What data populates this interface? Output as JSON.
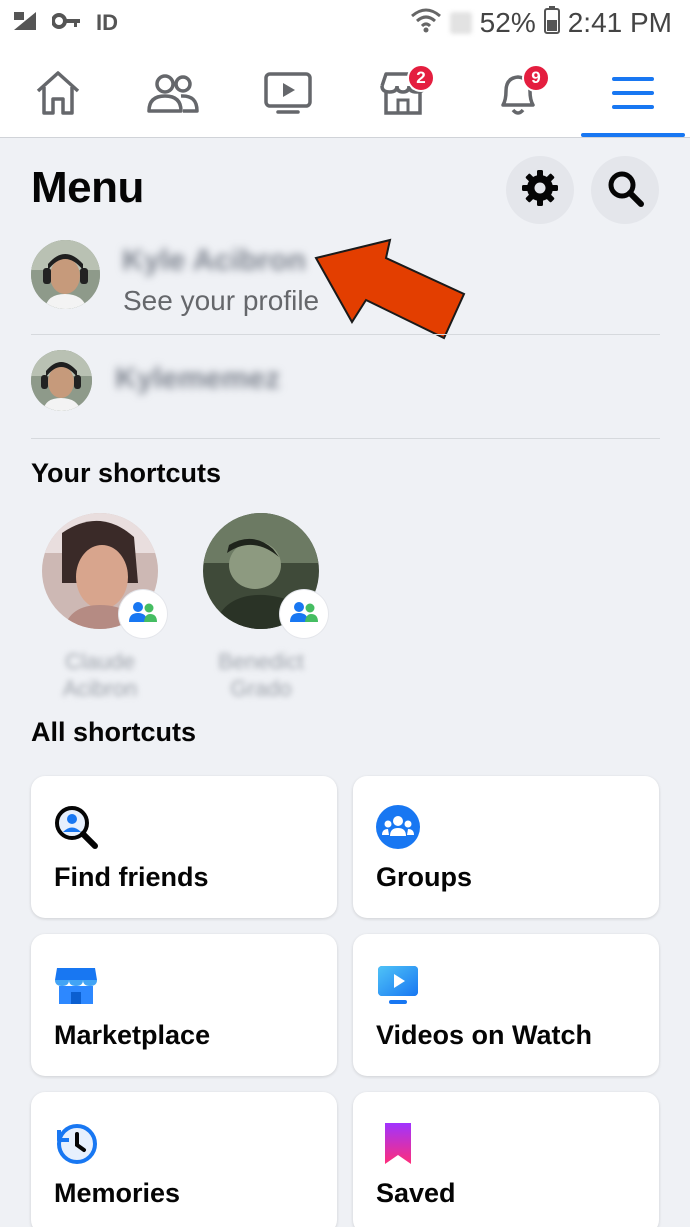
{
  "status_bar": {
    "battery": "52%",
    "time": "2:41 PM"
  },
  "nav": {
    "items": [
      {
        "name": "home",
        "icon": "home-icon"
      },
      {
        "name": "friends",
        "icon": "friends-icon"
      },
      {
        "name": "watch",
        "icon": "watch-icon"
      },
      {
        "name": "marketplace",
        "icon": "marketplace-icon",
        "badge": "2"
      },
      {
        "name": "notifications",
        "icon": "bell-icon",
        "badge": "9"
      },
      {
        "name": "menu",
        "icon": "hamburger-icon",
        "active": true
      }
    ],
    "accent": "#1877f2",
    "badge_color": "#e41e3f"
  },
  "header": {
    "title": "Menu"
  },
  "profile": {
    "name": "Kyle Acibron",
    "subtitle": "See your profile"
  },
  "secondary_profile": {
    "name": "Kylememez"
  },
  "shortcuts": {
    "title": "Your shortcuts",
    "items": [
      {
        "name_line1": "Claude",
        "name_line2": "Acibron"
      },
      {
        "name_line1": "Benedict",
        "name_line2": "Grado"
      }
    ]
  },
  "all_shortcuts": {
    "title": "All shortcuts",
    "cards": [
      {
        "label": "Find friends",
        "icon": "find-friends-icon"
      },
      {
        "label": "Groups",
        "icon": "groups-icon"
      },
      {
        "label": "Marketplace",
        "icon": "marketplace-store-icon"
      },
      {
        "label": "Videos on Watch",
        "icon": "watch-video-icon"
      },
      {
        "label": "Memories",
        "icon": "memories-icon"
      },
      {
        "label": "Saved",
        "icon": "saved-icon"
      }
    ]
  },
  "annotation": {
    "arrow_color": "#e33e00"
  }
}
